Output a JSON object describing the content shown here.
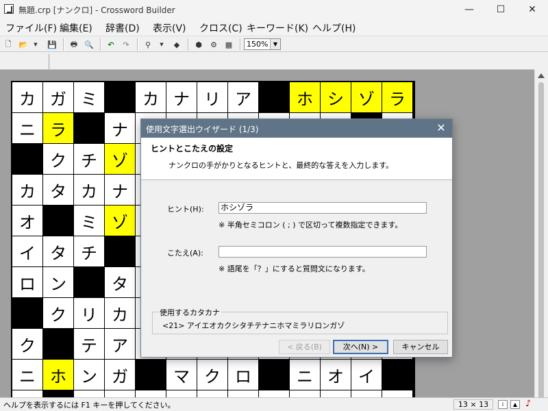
{
  "window": {
    "title": "無題.crp [ナンクロ] - Crossword Builder",
    "minimize": "—",
    "maximize": "☐",
    "close": "✕"
  },
  "menu": [
    "ファイル(F)",
    "編集(E)",
    "辞書(D)",
    "表示(V)",
    "クロス(C)",
    "キーワード(K)",
    "ヘルプ(H)"
  ],
  "toolbar": {
    "zoom": "150%"
  },
  "grid": {
    "rows": [
      [
        {
          "t": "カ"
        },
        {
          "t": "ガ"
        },
        {
          "t": "ミ"
        },
        {
          "s": "b"
        },
        {
          "t": "カ"
        },
        {
          "t": "ナ"
        },
        {
          "t": "リ"
        },
        {
          "t": "ア"
        },
        {
          "s": "b"
        },
        {
          "t": "ホ",
          "s": "y"
        },
        {
          "t": "シ",
          "s": "y"
        },
        {
          "t": "ゾ",
          "s": "y"
        },
        {
          "t": "ラ",
          "s": "y"
        }
      ],
      [
        {
          "t": "ニ"
        },
        {
          "t": "ラ",
          "s": "y"
        },
        {
          "s": "b"
        },
        {
          "t": "ナ"
        },
        {},
        {},
        {},
        {},
        {},
        {},
        {},
        {
          "s": "b"
        },
        {}
      ],
      [
        {
          "s": "b"
        },
        {
          "t": "ク"
        },
        {
          "t": "チ"
        },
        {
          "t": "ゾ",
          "s": "y"
        },
        {},
        {},
        {},
        {},
        {},
        {},
        {},
        {},
        {}
      ],
      [
        {
          "t": "カ"
        },
        {
          "t": "タ"
        },
        {
          "t": "カ"
        },
        {
          "t": "ナ"
        },
        {},
        {},
        {},
        {},
        {},
        {},
        {},
        {},
        {}
      ],
      [
        {
          "t": "オ"
        },
        {
          "s": "b"
        },
        {
          "t": "ミ"
        },
        {
          "t": "ゾ",
          "s": "y"
        },
        {},
        {},
        {},
        {},
        {},
        {},
        {},
        {},
        {}
      ],
      [
        {
          "t": "イ"
        },
        {
          "t": "タ"
        },
        {
          "t": "チ"
        },
        {
          "s": "b"
        },
        {},
        {},
        {},
        {},
        {},
        {},
        {},
        {},
        {}
      ],
      [
        {
          "t": "ロ"
        },
        {
          "t": "ン"
        },
        {
          "s": "b"
        },
        {
          "t": "タ"
        },
        {},
        {},
        {},
        {},
        {},
        {},
        {},
        {},
        {}
      ],
      [
        {
          "s": "b"
        },
        {
          "t": "ク"
        },
        {
          "t": "リ"
        },
        {
          "t": "カ"
        },
        {},
        {},
        {},
        {},
        {},
        {},
        {},
        {},
        {}
      ],
      [
        {
          "t": "ク"
        },
        {
          "s": "b"
        },
        {
          "t": "テ"
        },
        {
          "t": "ア"
        },
        {},
        {},
        {},
        {},
        {},
        {},
        {},
        {},
        {}
      ],
      [
        {
          "t": "ニ"
        },
        {
          "t": "ホ",
          "s": "y"
        },
        {
          "t": "ン"
        },
        {
          "t": "ガ"
        },
        {
          "s": "b"
        },
        {
          "t": "マ"
        },
        {
          "t": "ク"
        },
        {
          "t": "ロ"
        },
        {
          "s": "b"
        },
        {
          "t": "ニ"
        },
        {
          "t": "オ"
        },
        {
          "t": "イ"
        },
        {
          "s": "b"
        }
      ],
      [
        {},
        {
          "s": "b"
        },
        {},
        {},
        {},
        {},
        {},
        {},
        {},
        {},
        {},
        {},
        {}
      ]
    ]
  },
  "dialog": {
    "title": "使用文字選出ウイザード (1/3)",
    "close": "✕",
    "heading": "ヒントとこたえの設定",
    "description": "ナンクロの手がかりとなるヒントと、最終的な答えを入力します。",
    "hint_label": "ヒント(H):",
    "hint_value": "ホシゾラ",
    "hint_note": "※ 半角セミコロン ( ; ) で区切って複数指定できます。",
    "answer_label": "こたえ(A):",
    "answer_value": "",
    "answer_note": "※ 語尾を「？」にすると質問文になります。",
    "group_title": "使用するカタカナ",
    "group_content": "<21> アイエオカクシタチテナニホマミラリロンガゾ",
    "back_button": "< 戻る(B)",
    "next_button": "次へ(N) >",
    "cancel_button": "キャンセル"
  },
  "status": {
    "help_text": "ヘルプを表示するには F1 キーを押してください。",
    "grid_size": "13 × 13"
  }
}
